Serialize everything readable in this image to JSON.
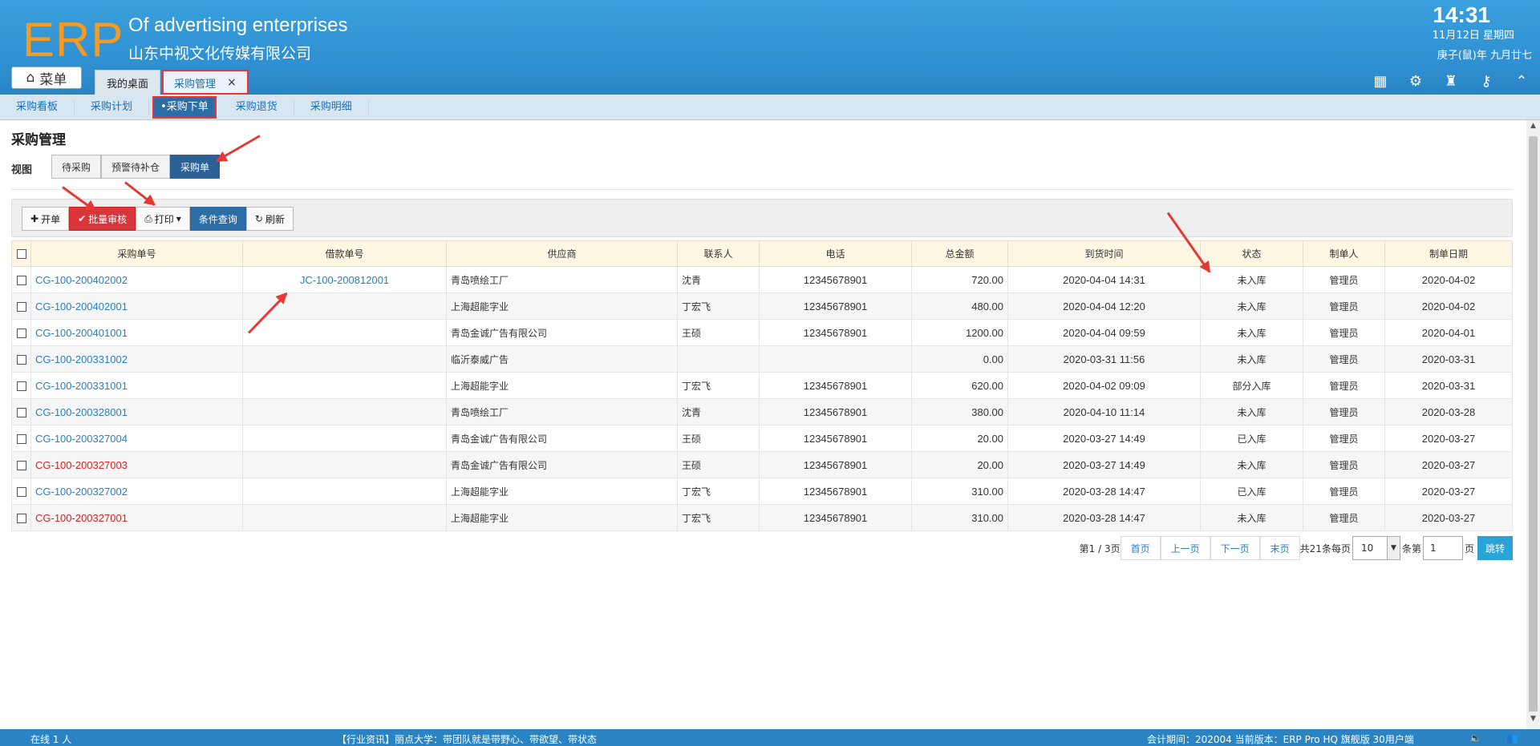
{
  "header": {
    "logo": "ERP",
    "brand_en": "Of advertising enterprises",
    "brand_cn": "山东中视文化传媒有限公司",
    "time": "14:31",
    "date": "11月12日 星期四",
    "lunar": "庚子(鼠)年 九月廿七",
    "menu_label": "菜单",
    "tabs": [
      {
        "label": "我的桌面"
      },
      {
        "label": "采购管理",
        "close": "×"
      }
    ]
  },
  "subnav": {
    "items": [
      "采购看板",
      "采购计划",
      "•采购下单",
      "采购退货",
      "采购明细"
    ]
  },
  "page": {
    "title": "采购管理",
    "view_label": "视图",
    "views": [
      "待采购",
      "预警待补仓",
      "采购单"
    ]
  },
  "toolbar": {
    "new": "开单",
    "batch_audit": "批量审核",
    "print": "打印",
    "query": "条件查询",
    "refresh": "刷新"
  },
  "table": {
    "headers": [
      "采购单号",
      "借款单号",
      "供应商",
      "联系人",
      "电话",
      "总金额",
      "到货时间",
      "状态",
      "制单人",
      "制单日期"
    ],
    "rows": [
      {
        "no": "CG-100-200402002",
        "no_red": false,
        "loan": "JC-100-200812001",
        "supplier": "青岛喷绘工厂",
        "contact": "沈青",
        "phone": "12345678901",
        "amount": "720.00",
        "arrival": "2020-04-04 14:31",
        "status": "未入库",
        "status_color": "red",
        "maker": "管理员",
        "date": "2020-04-02"
      },
      {
        "no": "CG-100-200402001",
        "no_red": false,
        "loan": "",
        "supplier": "上海超能字业",
        "contact": "丁宏飞",
        "phone": "12345678901",
        "amount": "480.00",
        "arrival": "2020-04-04 12:20",
        "status": "未入库",
        "status_color": "red",
        "maker": "管理员",
        "date": "2020-04-02"
      },
      {
        "no": "CG-100-200401001",
        "no_red": false,
        "loan": "",
        "supplier": "青岛金诚广告有限公司",
        "contact": "王硕",
        "phone": "12345678901",
        "amount": "1200.00",
        "arrival": "2020-04-04 09:59",
        "status": "未入库",
        "status_color": "red",
        "maker": "管理员",
        "date": "2020-04-01"
      },
      {
        "no": "CG-100-200331002",
        "no_red": false,
        "loan": "",
        "supplier": "临沂泰威广告",
        "contact": "",
        "phone": "",
        "amount": "0.00",
        "arrival": "2020-03-31 11:56",
        "status": "未入库",
        "status_color": "red",
        "maker": "管理员",
        "date": "2020-03-31"
      },
      {
        "no": "CG-100-200331001",
        "no_red": false,
        "loan": "",
        "supplier": "上海超能字业",
        "contact": "丁宏飞",
        "phone": "12345678901",
        "amount": "620.00",
        "arrival": "2020-04-02 09:09",
        "status": "部分入库",
        "status_color": "gray",
        "maker": "管理员",
        "date": "2020-03-31"
      },
      {
        "no": "CG-100-200328001",
        "no_red": false,
        "loan": "",
        "supplier": "青岛喷绘工厂",
        "contact": "沈青",
        "phone": "12345678901",
        "amount": "380.00",
        "arrival": "2020-04-10 11:14",
        "status": "未入库",
        "status_color": "red",
        "maker": "管理员",
        "date": "2020-03-28"
      },
      {
        "no": "CG-100-200327004",
        "no_red": false,
        "loan": "",
        "supplier": "青岛金诚广告有限公司",
        "contact": "王硕",
        "phone": "12345678901",
        "amount": "20.00",
        "arrival": "2020-03-27 14:49",
        "status": "已入库",
        "status_color": "green",
        "maker": "管理员",
        "date": "2020-03-27"
      },
      {
        "no": "CG-100-200327003",
        "no_red": true,
        "loan": "",
        "supplier": "青岛金诚广告有限公司",
        "contact": "王硕",
        "phone": "12345678901",
        "amount": "20.00",
        "arrival": "2020-03-27 14:49",
        "status": "未入库",
        "status_color": "red",
        "maker": "管理员",
        "date": "2020-03-27"
      },
      {
        "no": "CG-100-200327002",
        "no_red": false,
        "loan": "",
        "supplier": "上海超能字业",
        "contact": "丁宏飞",
        "phone": "12345678901",
        "amount": "310.00",
        "arrival": "2020-03-28 14:47",
        "status": "已入库",
        "status_color": "green",
        "maker": "管理员",
        "date": "2020-03-27"
      },
      {
        "no": "CG-100-200327001",
        "no_red": true,
        "loan": "",
        "supplier": "上海超能字业",
        "contact": "丁宏飞",
        "phone": "12345678901",
        "amount": "310.00",
        "arrival": "2020-03-28 14:47",
        "status": "未入库",
        "status_color": "red",
        "maker": "管理员",
        "date": "2020-03-27"
      }
    ]
  },
  "pager": {
    "page_info": "第1 / 3页",
    "first": "首页",
    "prev": "上一页",
    "next": "下一页",
    "last": "末页",
    "total_per": "共21条每页",
    "per_page": "10",
    "per_unit": "条第",
    "page_input": "1",
    "page_unit": "页",
    "go": "跳转"
  },
  "footer": {
    "online": "在线  1  人",
    "news": "【行业资讯】丽点大学：带团队就是带野心、带欲望、带状态",
    "info": "会计期间：202004 当前版本：ERP Pro HQ 旗舰版 30用户端"
  },
  "colors": {
    "accent": "#2c6da6",
    "header": "#3aa0de",
    "danger": "#d9363b",
    "logo": "#f59a23"
  }
}
